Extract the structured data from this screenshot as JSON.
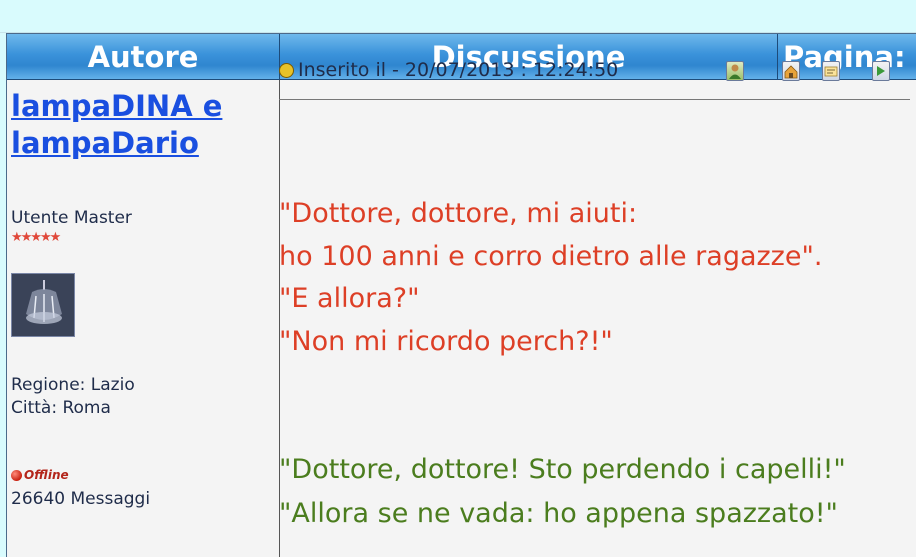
{
  "header": {
    "col_author": "Autore",
    "col_discussion": "Discussione",
    "col_page": "Pagina:"
  },
  "author": {
    "name": "lampaDINA e lampaDario",
    "rank": "Utente Master",
    "stars": "★★★★★",
    "region": "Regione: Lazio",
    "city": "Città: Roma",
    "status": "Offline",
    "messages": "26640 Messaggi"
  },
  "post": {
    "inserted": "Inserito il - 20/07/2013 : 12:24:50",
    "lines_red": [
      "\"Dottore, dottore, mi aiuti:",
      "ho 100 anni e corro dietro alle ragazze\".",
      "\"E allora?\"",
      "\"Non mi ricordo perch?!\""
    ],
    "lines_green": [
      "\"Dottore, dottore! Sto perdendo i capelli!\"",
      "\"Allora se ne vada: ho appena spazzato!\""
    ]
  },
  "colors": {
    "header_blue": "#3a92da",
    "link_blue": "#1a4fe0",
    "text_red": "#dd3f26",
    "text_green": "#4b7d1e"
  },
  "icons": [
    "profile-icon",
    "home-icon",
    "reply-quote-icon",
    "forward-icon"
  ]
}
